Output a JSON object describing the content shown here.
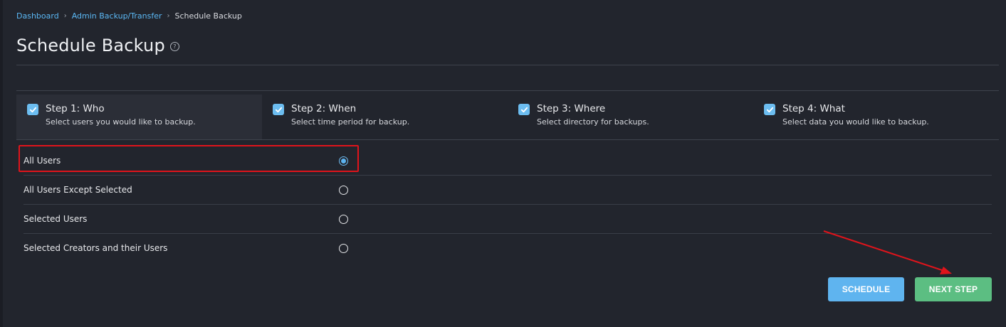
{
  "breadcrumb": {
    "items": [
      "Dashboard",
      "Admin Backup/Transfer"
    ],
    "current": "Schedule Backup",
    "separator": "›"
  },
  "page": {
    "title": "Schedule Backup",
    "help_icon": "?"
  },
  "steps": [
    {
      "title": "Step 1: Who",
      "subtitle": "Select users you would like to backup.",
      "checked": true,
      "active": true
    },
    {
      "title": "Step 2: When",
      "subtitle": "Select time period for backup.",
      "checked": true,
      "active": false
    },
    {
      "title": "Step 3: Where",
      "subtitle": "Select directory for backups.",
      "checked": true,
      "active": false
    },
    {
      "title": "Step 4: What",
      "subtitle": "Select data you would like to backup.",
      "checked": true,
      "active": false
    }
  ],
  "options": [
    {
      "label": "All Users",
      "selected": true
    },
    {
      "label": "All Users Except Selected",
      "selected": false
    },
    {
      "label": "Selected Users",
      "selected": false
    },
    {
      "label": "Selected Creators and their Users",
      "selected": false
    }
  ],
  "buttons": {
    "schedule": "SCHEDULE",
    "next_step": "NEXT STEP"
  },
  "colors": {
    "background": "#22252d",
    "accent_blue": "#5fb4ef",
    "accent_green": "#5cbe82",
    "annotation_red": "#e0141b"
  }
}
